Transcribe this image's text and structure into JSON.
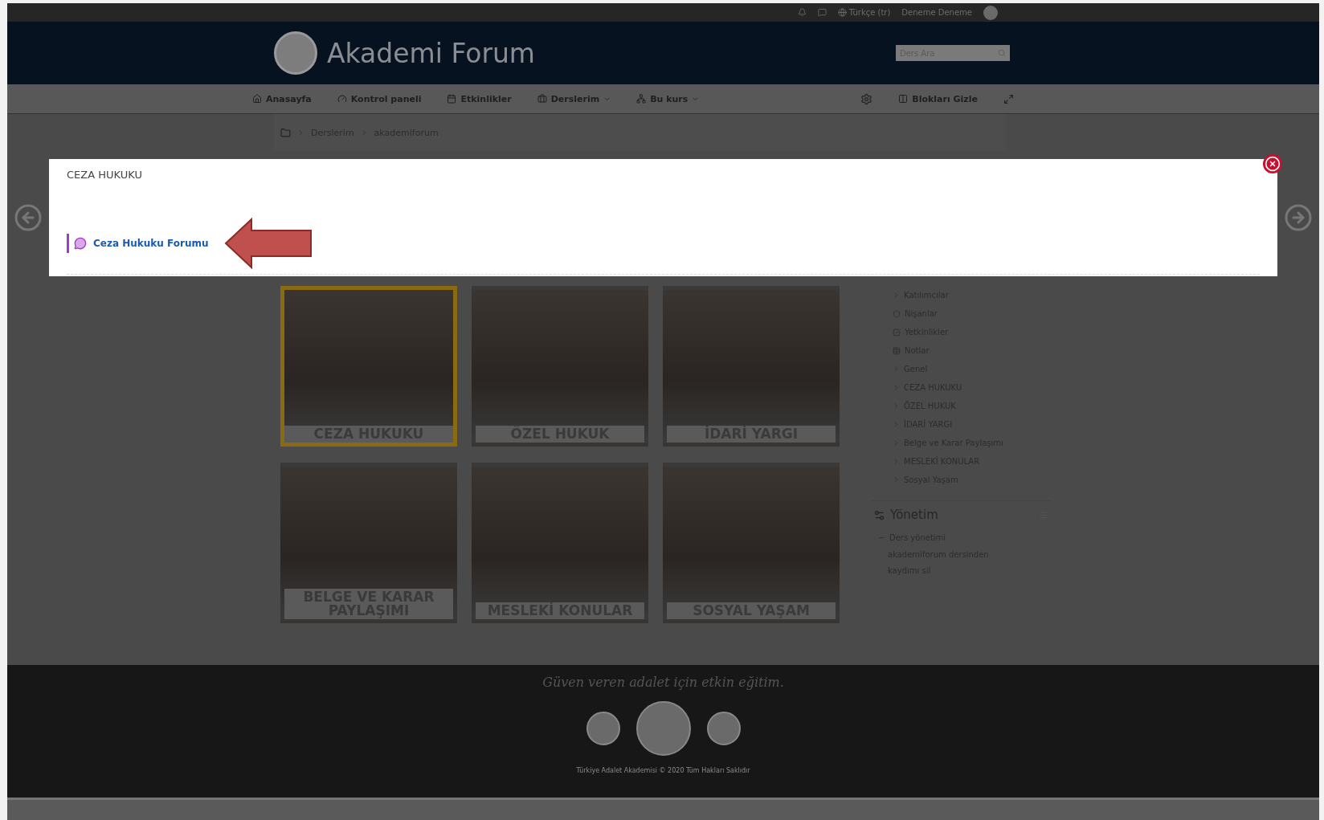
{
  "top_bar": {
    "language": "Türkçe (tr)",
    "user": "Deneme Deneme"
  },
  "header": {
    "site_title": "Akademi Forum",
    "search": {
      "placeholder": "Ders Ara"
    }
  },
  "nav": {
    "items": [
      {
        "label": "Anasayfa",
        "dropdown": false
      },
      {
        "label": "Kontrol paneli",
        "dropdown": false
      },
      {
        "label": "Etkinlikler",
        "dropdown": false
      },
      {
        "label": "Derslerim",
        "dropdown": true
      },
      {
        "label": "Bu kurs",
        "dropdown": true
      }
    ],
    "hide_blocks": "Blokları Gizle"
  },
  "breadcrumb": [
    "Derslerim",
    "akademiforum"
  ],
  "modal": {
    "title": "CEZA HUKUKU",
    "link": "Ceza Hukuku Forumu"
  },
  "tiles": [
    {
      "label": "CEZA HUKUKU",
      "selected": true
    },
    {
      "label": "ÖZEL HUKUK",
      "selected": false
    },
    {
      "label": "İDARİ YARGI",
      "selected": false
    },
    {
      "label": "BELGE VE KARAR PAYLAŞIMI",
      "selected": false
    },
    {
      "label": "MESLEKİ KONULAR",
      "selected": false
    },
    {
      "label": "SOSYAL YAŞAM",
      "selected": false
    }
  ],
  "sidebar": {
    "items": [
      {
        "label": "Katılımcılar",
        "kind": "section"
      },
      {
        "label": "Nişanlar",
        "kind": "link"
      },
      {
        "label": "Yetkinlikler",
        "kind": "link"
      },
      {
        "label": "Notlar",
        "kind": "link"
      },
      {
        "label": "Genel",
        "kind": "section"
      },
      {
        "label": "CEZA HUKUKU",
        "kind": "section"
      },
      {
        "label": "ÖZEL HUKUK",
        "kind": "section"
      },
      {
        "label": "İDARİ YARGI",
        "kind": "section"
      },
      {
        "label": "Belge ve Karar Paylaşımı",
        "kind": "section"
      },
      {
        "label": "MESLEKİ KONULAR",
        "kind": "section"
      },
      {
        "label": "Sosyal Yaşam",
        "kind": "section"
      }
    ],
    "admin": {
      "title": "Yönetim",
      "group": "Ders yönetimi",
      "action": "akademiforum dersinden kaydımı sil"
    }
  },
  "footer": {
    "motto": "Güven veren adalet için etkin eğitim.",
    "copyright": "Türkiye Adalet Akademisi © 2020 Tüm Hakları Saklıdır"
  }
}
